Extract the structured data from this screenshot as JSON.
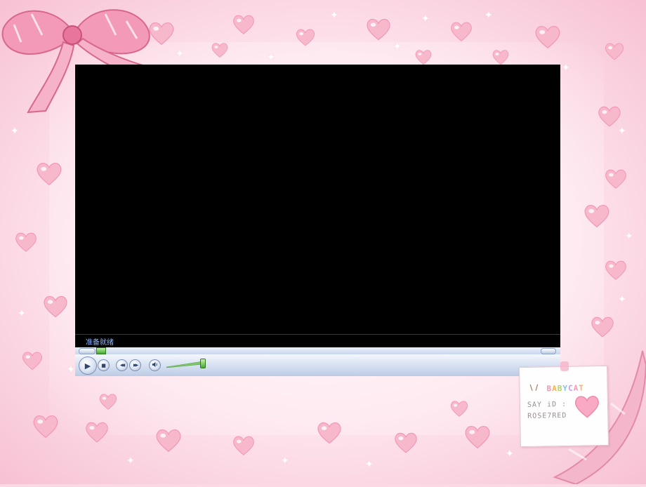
{
  "player": {
    "status_text": "准备就绪",
    "play_label": "▶",
    "stop_label": "■",
    "prev_label": "◀◀",
    "next_label": "▶▶",
    "mute_label": "🔈"
  },
  "note": {
    "brand_letters": [
      "B",
      "A",
      "B",
      "Y",
      "C",
      "A",
      "T"
    ],
    "line1": "SAY iD :",
    "line2": "ROSE7RED"
  },
  "colors": {
    "frame_pink": "#fbd9e4",
    "video_bg": "#000000",
    "status_text": "#8fb6ff",
    "seek_thumb": "#43a62d"
  }
}
